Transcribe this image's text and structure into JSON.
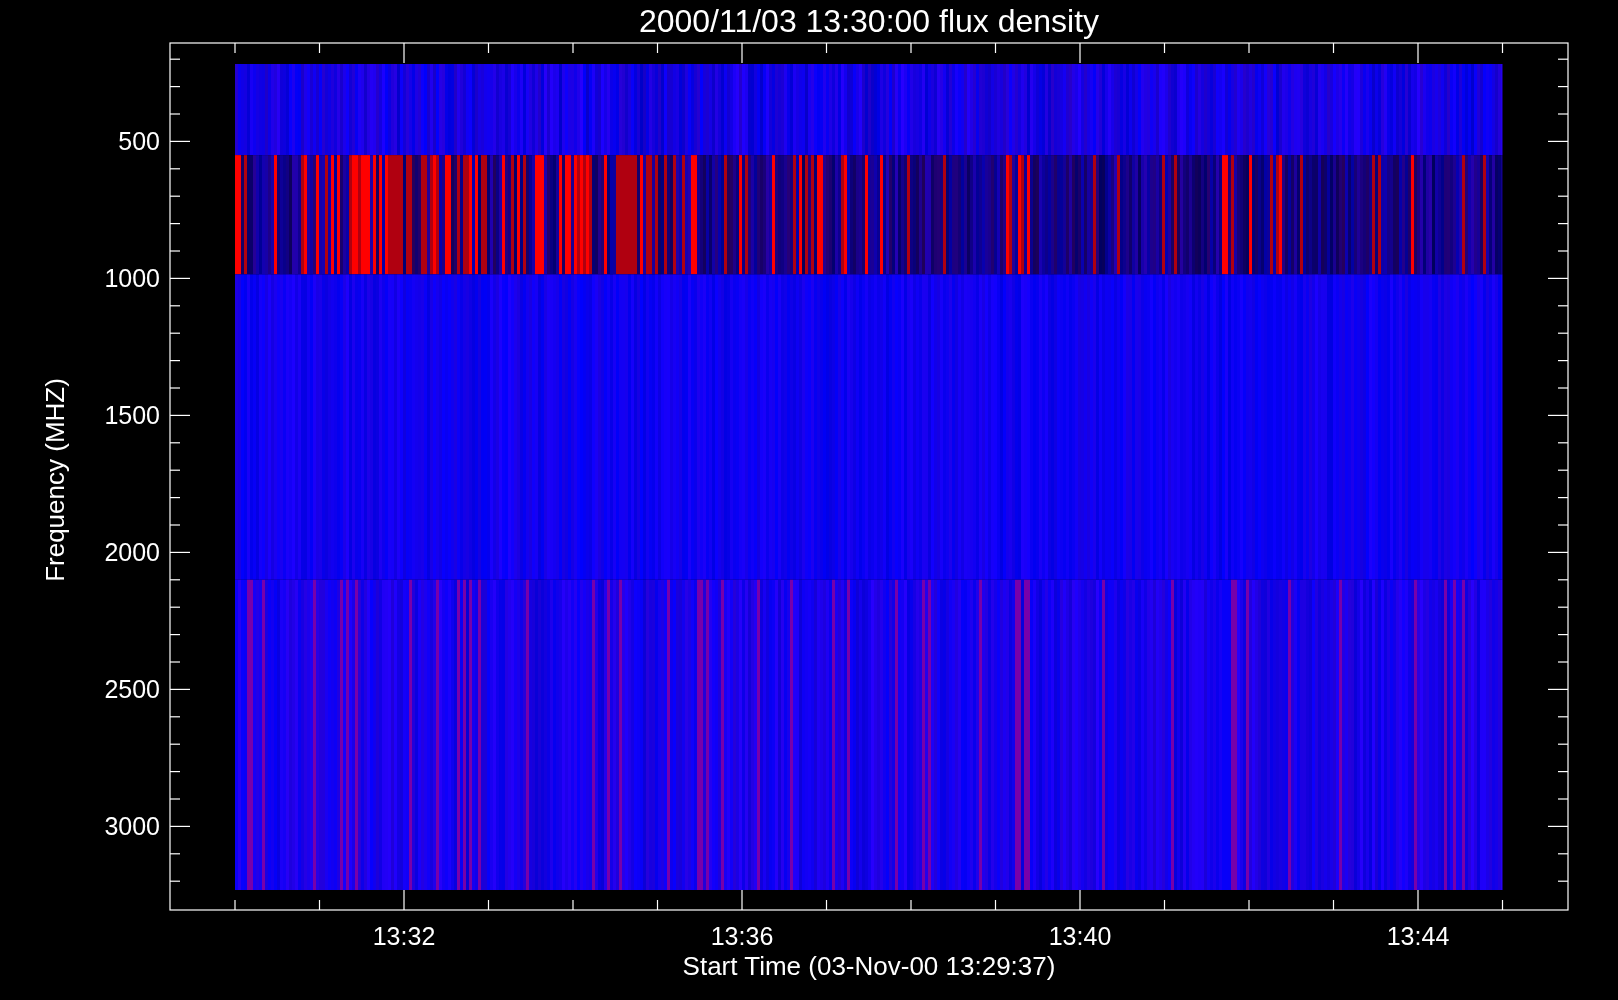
{
  "plot": {
    "title": "2000/11/03 13:30:00 flux density",
    "xlabel": "Start Time (03-Nov-00 13:29:37)",
    "ylabel": "Frequency (MHZ)",
    "xticks": [
      "13:32",
      "13:36",
      "13:40",
      "13:44"
    ],
    "yticks": [
      "500",
      "1000",
      "1500",
      "2000",
      "2500",
      "3000"
    ]
  }
}
